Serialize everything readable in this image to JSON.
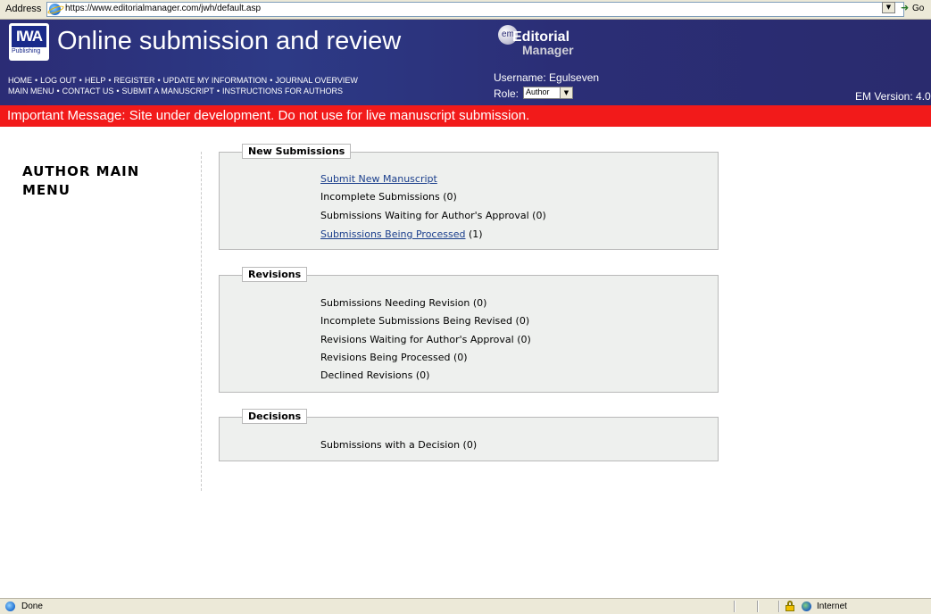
{
  "browser": {
    "address_label": "Address",
    "url": "https://www.editorialmanager.com/jwh/default.asp",
    "go_label": "Go",
    "status_text": "Done",
    "zone_text": "Internet"
  },
  "header": {
    "logo_text": "IWA",
    "logo_sub": "Publishing",
    "title": "Online submission and review",
    "em_badge": "em",
    "em_word1": "Editorial",
    "em_word2": "Manager",
    "nav_row1": [
      "HOME",
      "LOG OUT",
      "HELP",
      "REGISTER",
      "UPDATE MY INFORMATION",
      "JOURNAL OVERVIEW"
    ],
    "nav_row2": [
      "MAIN MENU",
      "CONTACT US",
      "SUBMIT A MANUSCRIPT",
      "INSTRUCTIONS FOR AUTHORS"
    ],
    "nav_separator": "•",
    "username": "Username: Egulseven",
    "role_label": "Role:",
    "role_value": "Author",
    "em_version": "EM Version: 4.0"
  },
  "alert": {
    "text": "Important Message: Site under development. Do not use for live manuscript submission."
  },
  "side": {
    "title_line1": "AUTHOR MAIN",
    "title_line2": "MENU"
  },
  "sections": {
    "new_submissions": {
      "legend": "New Submissions",
      "submit_new": "Submit New Manuscript",
      "incomplete": "Incomplete Submissions (0)",
      "waiting_approval": "Submissions Waiting for Author's Approval (0)",
      "being_processed_link": "Submissions Being Processed",
      "being_processed_count": "(1)"
    },
    "revisions": {
      "legend": "Revisions",
      "needing_revision": "Submissions Needing Revision (0)",
      "incomplete_revised": "Incomplete Submissions Being Revised (0)",
      "revisions_waiting": "Revisions Waiting for Author's Approval (0)",
      "revisions_processed": "Revisions Being Processed (0)",
      "declined": "Declined Revisions (0)"
    },
    "decisions": {
      "legend": "Decisions",
      "with_decision": "Submissions with a Decision (0)"
    }
  },
  "colors": {
    "header_bg": "#2b2c75",
    "alert_bg": "#f21a1a",
    "box_bg": "#eef0ee",
    "link": "#1a3e8c"
  }
}
